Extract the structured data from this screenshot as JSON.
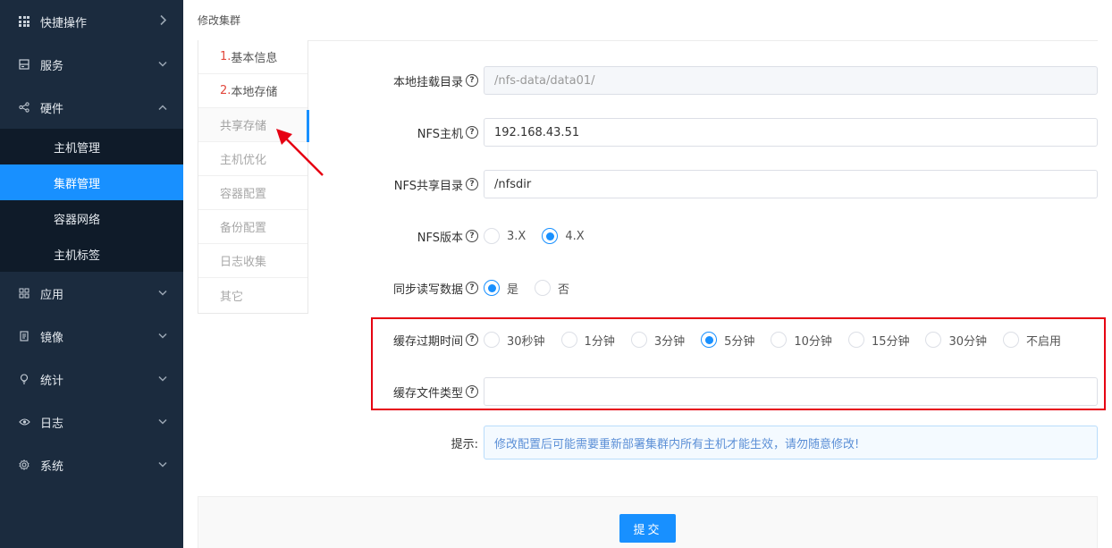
{
  "sidebar": {
    "items": [
      {
        "name": "quick-actions",
        "label": "快捷操作",
        "icon": "grid-icon",
        "chevron": "›"
      },
      {
        "name": "services",
        "label": "服务",
        "icon": "server-icon",
        "chevron": "⌄"
      },
      {
        "name": "hardware",
        "label": "硬件",
        "icon": "share-icon",
        "chevron": "⌃"
      },
      {
        "name": "apps",
        "label": "应用",
        "icon": "apps-icon",
        "chevron": "⌄"
      },
      {
        "name": "images",
        "label": "镜像",
        "icon": "file-icon",
        "chevron": "⌄"
      },
      {
        "name": "stats",
        "label": "统计",
        "icon": "bulb-icon",
        "chevron": "⌄"
      },
      {
        "name": "logs",
        "label": "日志",
        "icon": "eye-icon",
        "chevron": "⌄"
      },
      {
        "name": "system",
        "label": "系统",
        "icon": "gear-icon",
        "chevron": "⌄"
      }
    ],
    "hardware_sub": [
      "主机管理",
      "集群管理",
      "容器网络",
      "主机标签"
    ],
    "active_sub": "集群管理"
  },
  "page": {
    "title": "修改集群"
  },
  "steps": [
    {
      "num": "1.",
      "label": "基本信息"
    },
    {
      "num": "2.",
      "label": "本地存储"
    },
    {
      "num": "",
      "label": "共享存储"
    },
    {
      "num": "",
      "label": "主机优化"
    },
    {
      "num": "",
      "label": "容器配置"
    },
    {
      "num": "",
      "label": "备份配置"
    },
    {
      "num": "",
      "label": "日志收集"
    },
    {
      "num": "",
      "label": "其它"
    }
  ],
  "form": {
    "mount_dir": {
      "label": "本地挂载目录",
      "value": "/nfs-data/data01/"
    },
    "nfs_host": {
      "label": "NFS主机",
      "value": "192.168.43.51"
    },
    "nfs_share": {
      "label": "NFS共享目录",
      "value": "/nfsdir"
    },
    "nfs_version": {
      "label": "NFS版本",
      "options": [
        "3.X",
        "4.X"
      ],
      "selected": "4.X"
    },
    "sync_rw": {
      "label": "同步读写数据",
      "options": [
        "是",
        "否"
      ],
      "selected": "是"
    },
    "cache_expire": {
      "label": "缓存过期时间",
      "options": [
        "30秒钟",
        "1分钟",
        "3分钟",
        "5分钟",
        "10分钟",
        "15分钟",
        "30分钟",
        "不启用"
      ],
      "selected": "5分钟"
    },
    "cache_types": {
      "label": "缓存文件类型",
      "value": ""
    },
    "hint": {
      "label": "提示:",
      "text": "修改配置后可能需要重新部署集群内所有主机才能生效，请勿随意修改!"
    }
  },
  "help_glyph": "?",
  "submit_label": "提交",
  "colors": {
    "accent": "#1890ff",
    "sidebar_bg": "#1b2b3e",
    "highlight": "#e60012",
    "step_number": "#e2483d"
  }
}
